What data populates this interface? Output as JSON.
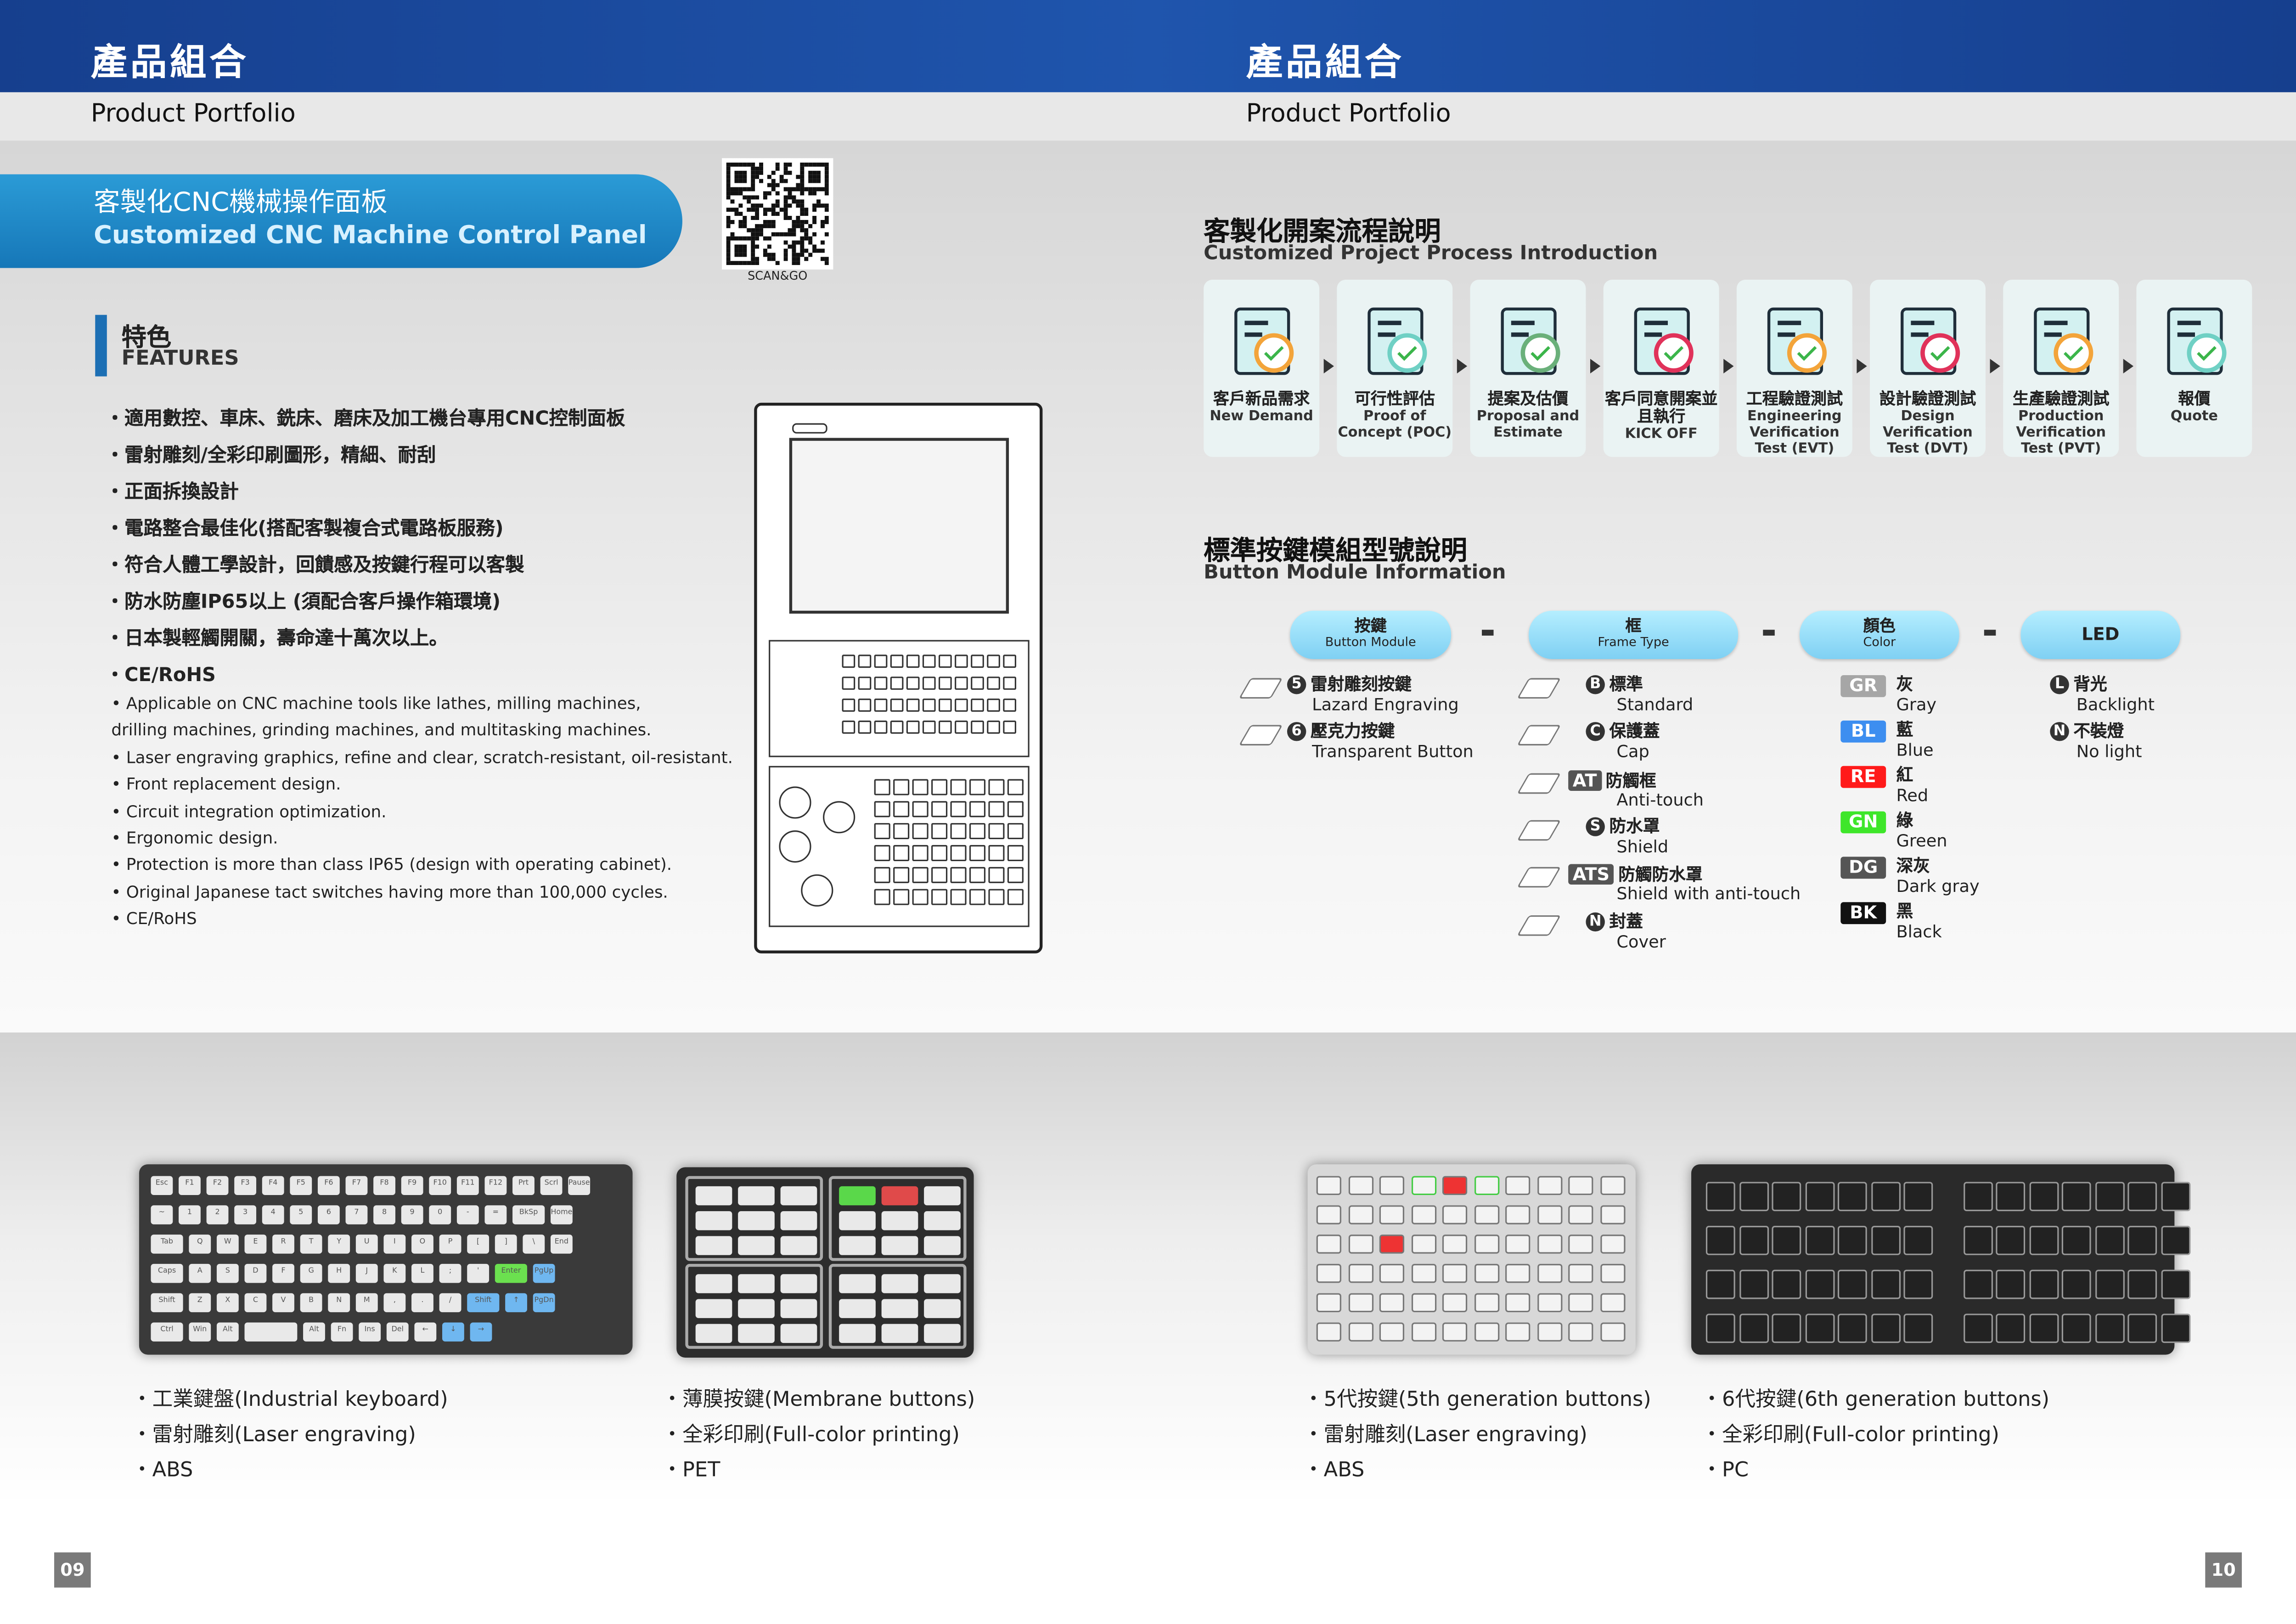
{
  "header": {
    "left_title": "產品組合",
    "right_title": "產品組合",
    "left_subtitle": "Product Portfolio",
    "right_subtitle": "Product Portfolio",
    "accent": "#1f55ad"
  },
  "left_page": {
    "banner": {
      "title_cn": "客製化CNC機械操作面板",
      "title_en": "Customized CNC Machine Control Panel"
    },
    "qr": {
      "label": "SCAN&GO"
    },
    "features": {
      "title_cn": "特色",
      "title_en": "FEATURES",
      "items_cn": [
        "・適用數控、車床、銑床、磨床及加工機台專用CNC控制面板",
        "・雷射雕刻/全彩印刷圖形，精細、耐刮",
        "・正面拆換設計",
        "・電路整合最佳化(搭配客製複合式電路板服務)",
        "・符合人體工學設計，回饋感及按鍵行程可以客製",
        "・防水防塵IP65以上 (須配合客戶操作箱環境)",
        "・日本製輕觸開關，壽命達十萬次以上。",
        "・CE/RoHS"
      ],
      "items_en": [
        "• Applicable on CNC machine tools like lathes, milling machines,",
        "   drilling machines, grinding machines, and multitasking machines.",
        "• Laser engraving graphics, refine and clear, scratch-resistant, oil-resistant.",
        "• Front replacement design.",
        "• Circuit integration optimization.",
        "• Ergonomic design.",
        "• Protection is more than class IP65 (design with operating cabinet).",
        "• Original Japanese tact switches having more than 100,000 cycles.",
        "• CE/RoHS"
      ]
    },
    "page_number": "09"
  },
  "right_page": {
    "process": {
      "title_cn": "客製化開案流程說明",
      "title_en": "Customized Project Process Introduction",
      "steps": [
        {
          "cn": "客戶新品需求",
          "en": "New Demand",
          "icon": "new-demand-icon"
        },
        {
          "cn": "可行性評估",
          "en": "Proof of Concept (POC)",
          "icon": "checklist-icon"
        },
        {
          "cn": "提案及估價",
          "en": "Proposal and Estimate",
          "icon": "money-plant-icon"
        },
        {
          "cn": "客戶同意開案並且執行",
          "en": "KICK OFF",
          "icon": "handover-icon"
        },
        {
          "cn": "工程驗證測試",
          "en": "Engineering Verification Test (EVT)",
          "icon": "engineer-inspect-icon"
        },
        {
          "cn": "設計驗證測試",
          "en": "Design Verification Test (DVT)",
          "icon": "clipboard-inspect-icon"
        },
        {
          "cn": "生產驗證測試",
          "en": "Production Verification Test (PVT)",
          "icon": "gear-inspect-icon"
        },
        {
          "cn": "報價",
          "en": "Quote",
          "icon": "handshake-icon"
        }
      ]
    },
    "module": {
      "title_cn": "標準按鍵模組型號說明",
      "title_en": "Button Module Information",
      "headers": [
        {
          "cn": "按鍵",
          "en": "Button Module"
        },
        {
          "cn": "框",
          "en": "Frame Type"
        },
        {
          "cn": "顏色",
          "en": "Color"
        },
        {
          "cn": "",
          "en": "LED"
        }
      ],
      "separator": "-",
      "buttons": [
        {
          "code": "5",
          "cn": "雷射雕刻按鍵",
          "en": "Lazard Engraving"
        },
        {
          "code": "6",
          "cn": "壓克力按鍵",
          "en": "Transparent Button"
        }
      ],
      "frames": [
        {
          "code": "B",
          "cn": "標準",
          "en": "Standard"
        },
        {
          "code": "C",
          "cn": "保護蓋",
          "en": "Cap"
        },
        {
          "code": "AT",
          "cn": "防觸框",
          "en": "Anti-touch"
        },
        {
          "code": "S",
          "cn": "防水罩",
          "en": "Shield"
        },
        {
          "code": "ATS",
          "cn": "防觸防水罩",
          "en": "Shield with anti-touch"
        },
        {
          "code": "N",
          "cn": "封蓋",
          "en": "Cover"
        }
      ],
      "colors": [
        {
          "code": "GR",
          "cn": "灰",
          "en": "Gray",
          "hex": "#a6a6a6"
        },
        {
          "code": "BL",
          "cn": "藍",
          "en": "Blue",
          "hex": "#3d8ef0"
        },
        {
          "code": "RE",
          "cn": "紅",
          "en": "Red",
          "hex": "#ff1a1a"
        },
        {
          "code": "GN",
          "cn": "綠",
          "en": "Green",
          "hex": "#3ee62a"
        },
        {
          "code": "DG",
          "cn": "深灰",
          "en": "Dark gray",
          "hex": "#555555"
        },
        {
          "code": "BK",
          "cn": "黑",
          "en": "Black",
          "hex": "#111111"
        }
      ],
      "leds": [
        {
          "code": "L",
          "cn": "背光",
          "en": "Backlight"
        },
        {
          "code": "N",
          "cn": "不裝燈",
          "en": "No light"
        }
      ]
    },
    "page_number": "10"
  },
  "products": [
    {
      "lines": [
        "・工業鍵盤(Industrial keyboard)",
        "・雷射雕刻(Laser engraving)",
        "・ABS"
      ]
    },
    {
      "lines": [
        "・薄膜按鍵(Membrane buttons)",
        "・全彩印刷(Full-color printing)",
        "・PET"
      ]
    },
    {
      "lines": [
        "・5代按鍵(5th generation buttons)",
        "・雷射雕刻(Laser engraving)",
        "・ABS"
      ]
    },
    {
      "lines": [
        "・6代按鍵(6th generation buttons)",
        "・全彩印刷(Full-color printing)",
        "・PC"
      ]
    }
  ],
  "keyboard": {
    "rows": [
      [
        "Esc",
        "F1",
        "F2",
        "F3",
        "F4",
        "F5",
        "F6",
        "F7",
        "F8",
        "F9",
        "F10",
        "F11",
        "F12",
        "Prt",
        "Scrl",
        "Pause"
      ],
      [
        "~",
        "1",
        "2",
        "3",
        "4",
        "5",
        "6",
        "7",
        "8",
        "9",
        "0",
        "-",
        "=",
        "BkSp",
        "Home"
      ],
      [
        "Tab",
        "Q",
        "W",
        "E",
        "R",
        "T",
        "Y",
        "U",
        "I",
        "O",
        "P",
        "[",
        "]",
        "\\",
        "End"
      ],
      [
        "Caps",
        "A",
        "S",
        "D",
        "F",
        "G",
        "H",
        "J",
        "K",
        "L",
        ";",
        "'",
        "Enter",
        "PgUp"
      ],
      [
        "Shift",
        "Z",
        "X",
        "C",
        "V",
        "B",
        "N",
        "M",
        ",",
        ".",
        "/",
        "Shift",
        "↑",
        "PgDn"
      ],
      [
        "Ctrl",
        "Win",
        "Alt",
        "",
        "Alt",
        "Fn",
        "Ins",
        "Del",
        "←",
        "↓",
        "→"
      ]
    ]
  }
}
